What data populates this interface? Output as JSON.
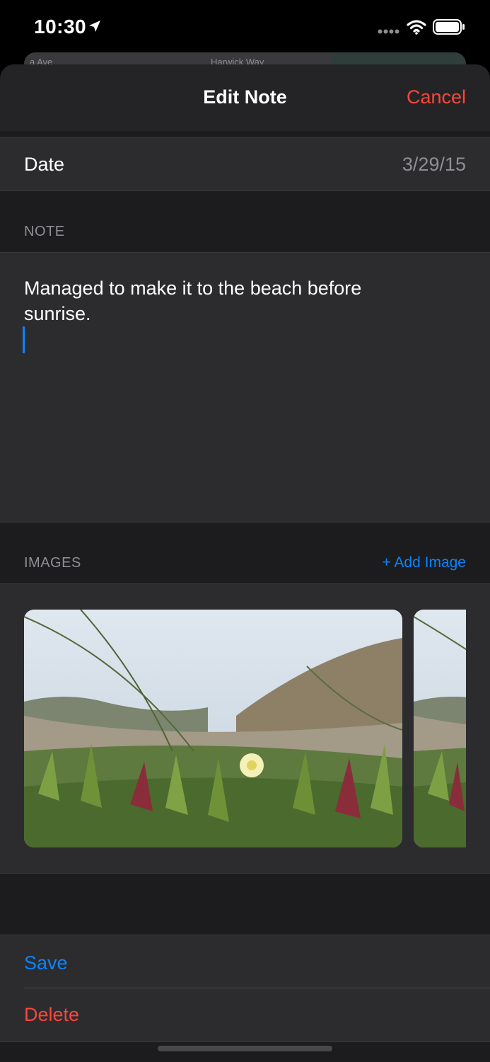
{
  "status_bar": {
    "time": "10:30",
    "icons": [
      "location-arrow-icon",
      "cellular-signal-icon",
      "wifi-icon",
      "battery-icon"
    ]
  },
  "background_map": {
    "street_left": "a Ave",
    "street_right": "Harwick Way"
  },
  "nav": {
    "title": "Edit Note",
    "cancel_label": "Cancel"
  },
  "date_row": {
    "label": "Date",
    "value": "3/29/15"
  },
  "note_section": {
    "header": "NOTE",
    "text": "Managed to make it to the beach before sunrise."
  },
  "images_section": {
    "header": "IMAGES",
    "add_label": "+ Add Image",
    "images": [
      {
        "subject": "beach-flower-photo"
      },
      {
        "subject": "beach-flower-photo"
      }
    ]
  },
  "actions": {
    "save_label": "Save",
    "delete_label": "Delete"
  },
  "colors": {
    "accent_blue": "#0a84ff",
    "destructive_red": "#ff453a",
    "secondary_text": "#8e8e93",
    "sheet_background": "#1c1c1e",
    "cell_background": "#2c2c2e"
  }
}
